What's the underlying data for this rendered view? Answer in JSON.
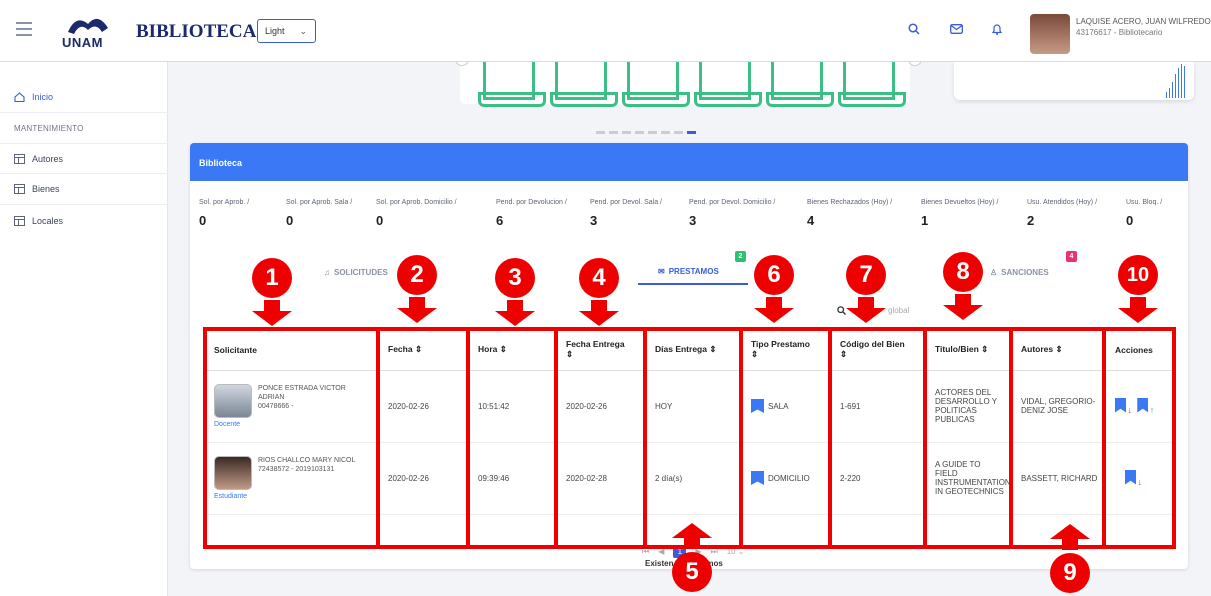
{
  "header": {
    "logo_word": "UNAM",
    "brand": "BIBLIOTECA",
    "theme_select": "Light",
    "user_name": "LAQUISE ACERO, JUAN WILFREDO",
    "user_role": "43176617 - Bibliotecario"
  },
  "sidebar": {
    "inicio": "Inicio",
    "section": "MANTENIMIENTO",
    "items": [
      "Autores",
      "Bienes",
      "Locales"
    ]
  },
  "panel": {
    "title": "Biblioteca",
    "stats": [
      {
        "label": "Sol. por Aprob. /",
        "value": "0"
      },
      {
        "label": "Sol. por Aprob. Sala /",
        "value": "0"
      },
      {
        "label": "Sol. por Aprob. Domicilio /",
        "value": "0"
      },
      {
        "label": "Pend. por Devolucion /",
        "value": "6"
      },
      {
        "label": "Pend. por Devol. Sala /",
        "value": "3"
      },
      {
        "label": "Pend. por Devol. Domicilio /",
        "value": "3"
      },
      {
        "label": "Bienes Rechazados (Hoy) /",
        "value": "4"
      },
      {
        "label": "Bienes Devueltos (Hoy) /",
        "value": "1"
      },
      {
        "label": "Usu. Atendidos (Hoy) /",
        "value": "2"
      },
      {
        "label": "Usu. Bloq. /",
        "value": "0"
      }
    ],
    "tabs": [
      {
        "label": "SOLICITUDES",
        "badge": ""
      },
      {
        "label": "PRESTAMOS",
        "badge": "2"
      },
      {
        "label": "SANCIONES",
        "badge": "4"
      }
    ],
    "search_placeholder": "global"
  },
  "table": {
    "headers": [
      "Solicitante",
      "Fecha",
      "Hora",
      "Fecha Entrega",
      "Días Entrega",
      "Tipo Prestamo",
      "Código del Bien",
      "Titulo/Bien",
      "Autores",
      "Acciones"
    ],
    "sort_icon": "⇕",
    "rows": [
      {
        "name": "PONCE ESTRADA VICTOR ADRIAN",
        "id": "00478666 -",
        "role": "Docente",
        "fecha": "2020-02-26",
        "hora": "10:51:42",
        "fecha_entrega": "2020-02-26",
        "dias": "HOY",
        "tipo": "SALA",
        "codigo": "1-691",
        "titulo": "ACTORES DEL DESARROLLO Y POLITICAS PUBLICAS",
        "autores": "VIDAL, GREGORIO-DENIZ JOSE"
      },
      {
        "name": "RIOS CHALLCO MARY NICOL",
        "id": "72438572 - 2019103131",
        "role": "Estudiante",
        "fecha": "2020-02-26",
        "hora": "09:39:46",
        "fecha_entrega": "2020-02-28",
        "dias": "2 día(s)",
        "tipo": "DOMICILIO",
        "codigo": "2-220",
        "titulo": "A GUIDE TO FIELD INSTRUMENTATION IN GEOTECHNICS",
        "autores": "BASSETT, RICHARD"
      }
    ]
  },
  "pager": {
    "page": "1",
    "size": "10",
    "total": "Existen 2 prestamos"
  },
  "callouts": [
    "1",
    "2",
    "3",
    "4",
    "5",
    "6",
    "7",
    "8",
    "9",
    "10"
  ],
  "colors": {
    "accent": "#3b5bdb",
    "header_blue": "#3b78f5",
    "callout_red": "#ee0000",
    "green": "#3cbf86"
  }
}
